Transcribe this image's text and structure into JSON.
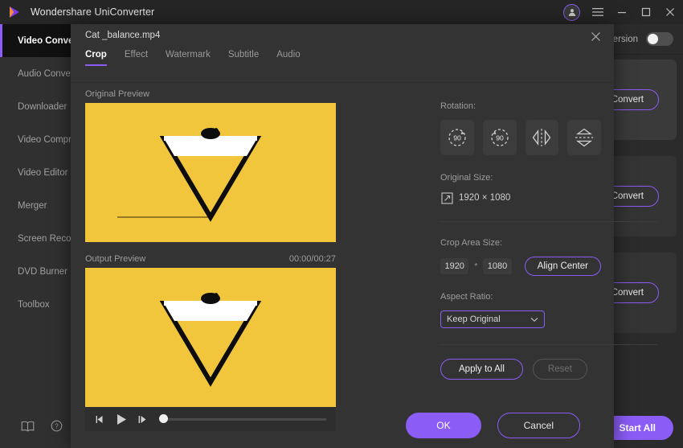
{
  "window": {
    "app_title": "Wondershare UniConverter",
    "logo_icon": "wondershare-play-logo",
    "avatar_icon": "user-avatar-icon",
    "menu_icon": "hamburger-menu-icon",
    "minimize_icon": "minimize-icon",
    "maximize_icon": "maximize-icon",
    "close_icon": "close-icon",
    "accent_color": "#8b5cf6"
  },
  "sidebar": {
    "items": [
      {
        "label": "Video Converter",
        "active": true
      },
      {
        "label": "Audio Converter",
        "active": false
      },
      {
        "label": "Downloader",
        "active": false
      },
      {
        "label": "Video Compressor",
        "active": false
      },
      {
        "label": "Video Editor",
        "active": false
      },
      {
        "label": "Merger",
        "active": false
      },
      {
        "label": "Screen Recorder",
        "active": false
      },
      {
        "label": "DVD Burner",
        "active": false
      },
      {
        "label": "Toolbox",
        "active": false
      }
    ],
    "manual_icon": "book-icon",
    "help_icon": "help-circle-icon"
  },
  "main": {
    "auto_conversion_label": "Auto Conversion",
    "toggle_state": "off",
    "convert_label_1": "Convert",
    "convert_label_2": "Convert",
    "convert_label_3": "Convert",
    "start_all_label": "Start All"
  },
  "modal": {
    "filename": "Cat _balance.mp4",
    "close_icon": "close-icon",
    "tabs": [
      {
        "label": "Crop",
        "active": true
      },
      {
        "label": "Effect",
        "active": false
      },
      {
        "label": "Watermark",
        "active": false
      },
      {
        "label": "Subtitle",
        "active": false
      },
      {
        "label": "Audio",
        "active": false
      }
    ],
    "preview": {
      "original_label": "Original Preview",
      "output_label": "Output Preview",
      "timecode": "00:00/00:27",
      "video_bg_color": "#f2c63c",
      "prev_frame_icon": "previous-frame-icon",
      "play_icon": "play-icon",
      "next_frame_icon": "next-frame-icon"
    },
    "rotation": {
      "label": "Rotation:",
      "buttons": [
        {
          "name": "rotate-right-90-icon",
          "value": "90"
        },
        {
          "name": "rotate-left-90-icon",
          "value": "90"
        },
        {
          "name": "flip-horizontal-icon",
          "value": ""
        },
        {
          "name": "flip-vertical-icon",
          "value": ""
        }
      ]
    },
    "original_size": {
      "label": "Original Size:",
      "icon": "resize-icon",
      "value": "1920 × 1080"
    },
    "crop_area": {
      "label": "Crop Area Size:",
      "width": "1920",
      "separator": "*",
      "height": "1080",
      "align_center_label": "Align Center"
    },
    "aspect_ratio": {
      "label": "Aspect Ratio:",
      "selected": "Keep Original",
      "chevron_icon": "chevron-down-icon"
    },
    "actions": {
      "apply_label": "Apply to All",
      "reset_label": "Reset"
    },
    "footer": {
      "ok_label": "OK",
      "cancel_label": "Cancel"
    }
  }
}
